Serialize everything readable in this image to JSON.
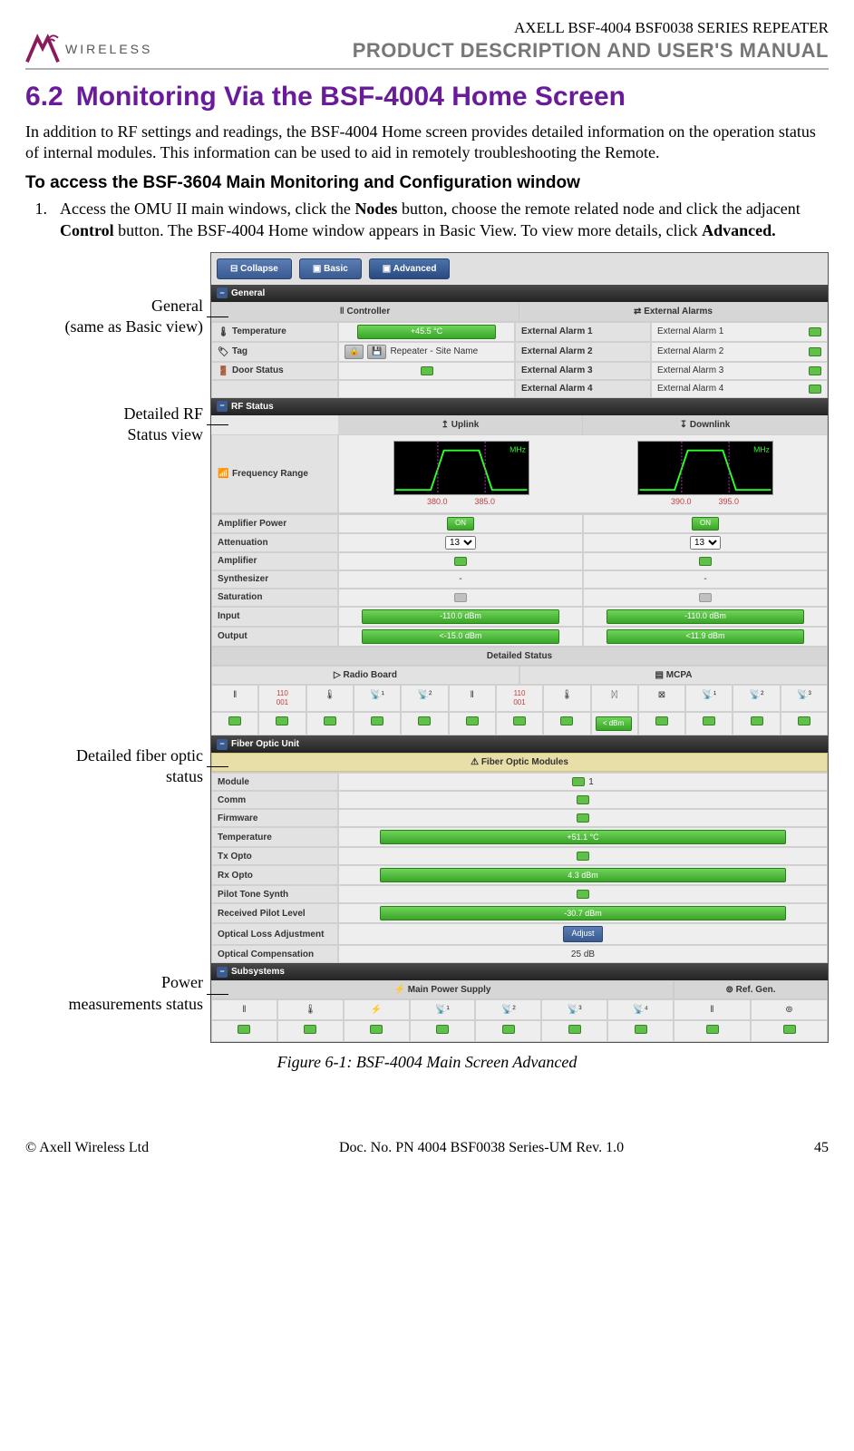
{
  "header": {
    "logo_text": "WIRELESS",
    "line1": "AXELL BSF-4004 BSF0038 SERIES REPEATER",
    "line2": "PRODUCT DESCRIPTION AND USER'S MANUAL"
  },
  "section": {
    "number": "6.2",
    "title": "Monitoring Via the BSF-4004 Home Screen",
    "intro": "In addition to RF settings and readings, the BSF-4004 Home screen provides detailed information on the operation status of internal modules. This information can be used to aid in remotely troubleshooting the Remote.",
    "subhead": "To access the BSF-3604 Main Monitoring and Configuration window",
    "step_num": "1.",
    "step_text_a": "Access the OMU II main windows, click the ",
    "step_bold_a": "Nodes",
    "step_text_b": " button, choose the remote related node and click the adjacent ",
    "step_bold_b": "Control",
    "step_text_c": " button. The BSF-4004 Home window appears in Basic View. To view more details, click ",
    "step_bold_c": "Advanced."
  },
  "labels": {
    "general_l1": "General",
    "general_l2": "(same as Basic view)",
    "rf_l1": "Detailed RF",
    "rf_l2": "Status view",
    "fiber_l1": "Detailed fiber optic",
    "fiber_l2": "status",
    "power_l1": "Power",
    "power_l2": "measurements status"
  },
  "tabs": {
    "collapse": "Collapse",
    "basic": "Basic",
    "advanced": "Advanced"
  },
  "general": {
    "title": "General",
    "controller": "Controller",
    "ext_alarms": "External Alarms",
    "temperature_label": "Temperature",
    "temperature_value": "+45.5 °C",
    "tag_label": "Tag",
    "tag_value": "Repeater - Site Name",
    "door_label": "Door Status",
    "ea1_label": "External Alarm 1",
    "ea1_value": "External Alarm 1",
    "ea2_label": "External Alarm 2",
    "ea2_value": "External Alarm 2",
    "ea3_label": "External Alarm 3",
    "ea3_value": "External Alarm 3",
    "ea4_label": "External Alarm 4",
    "ea4_value": "External Alarm 4"
  },
  "rf": {
    "title": "RF Status",
    "uplink": "Uplink",
    "downlink": "Downlink",
    "freq_label": "Frequency Range",
    "mhz": "MHz",
    "ul_t1": "380.0",
    "ul_t2": "385.0",
    "dl_t1": "390.0",
    "dl_t2": "395.0",
    "amp_power": "Amplifier Power",
    "attenuation": "Attenuation",
    "att_val": "13",
    "amplifier": "Amplifier",
    "synthesizer": "Synthesizer",
    "saturation": "Saturation",
    "input": "Input",
    "input_val": "-110.0 dBm",
    "output": "Output",
    "output_ul": "<-15.0 dBm",
    "output_dl": "<11.9 dBm",
    "on": "ON",
    "detailed": "Detailed Status",
    "radio_board": "Radio Board",
    "mcpa": "MCPA",
    "mcpa_reading": "< dBm"
  },
  "fiber": {
    "title": "Fiber Optic Unit",
    "modules": "Fiber Optic Modules",
    "module_label": "Module",
    "module_val": "1",
    "comm": "Comm",
    "firmware": "Firmware",
    "temperature": "Temperature",
    "temperature_val": "+51.1 °C",
    "tx_opto": "Tx Opto",
    "rx_opto": "Rx Opto",
    "rx_val": "4.3 dBm",
    "pilot": "Pilot Tone Synth",
    "recv_pilot": "Received Pilot Level",
    "recv_val": "-30.7 dBm",
    "opt_loss": "Optical Loss Adjustment",
    "adjust": "Adjust",
    "opt_comp": "Optical Compensation",
    "comp_val": "25 dB"
  },
  "subsystems": {
    "title": "Subsystems",
    "main_ps": "Main Power Supply",
    "ref_gen": "Ref. Gen."
  },
  "caption": "Figure 6-1: BSF-4004 Main Screen Advanced",
  "footer": {
    "left": "© Axell Wireless Ltd",
    "center": "Doc. No. PN 4004 BSF0038 Series-UM Rev. 1.0",
    "right": "45"
  }
}
